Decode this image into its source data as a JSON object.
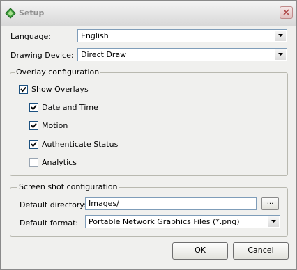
{
  "window": {
    "title": "Setup",
    "icon": "green-diamond-app-icon",
    "close_icon": "close-icon"
  },
  "language": {
    "label": "Language:",
    "value": "English"
  },
  "drawing_device": {
    "label": "Drawing Device:",
    "value": "Direct Draw"
  },
  "overlay": {
    "legend": "Overlay configuration",
    "show_overlays": {
      "label": "Show Overlays",
      "checked": true
    },
    "items": [
      {
        "label": "Date and Time",
        "checked": true
      },
      {
        "label": "Motion",
        "checked": true
      },
      {
        "label": "Authenticate Status",
        "checked": true
      },
      {
        "label": "Analytics",
        "checked": false
      }
    ]
  },
  "screenshot": {
    "legend": "Screen shot configuration",
    "directory_label": "Default directory:",
    "directory_value": "Images/",
    "browse_label": "...",
    "format_label": "Default format:",
    "format_value": "Portable Network Graphics Files (*.png)"
  },
  "buttons": {
    "ok": "OK",
    "cancel": "Cancel"
  },
  "colors": {
    "window_bg": "#f0f0ee",
    "field_border": "#7f9db9",
    "checkbox_border": "#1c5180",
    "check_mark": "#21a121"
  }
}
